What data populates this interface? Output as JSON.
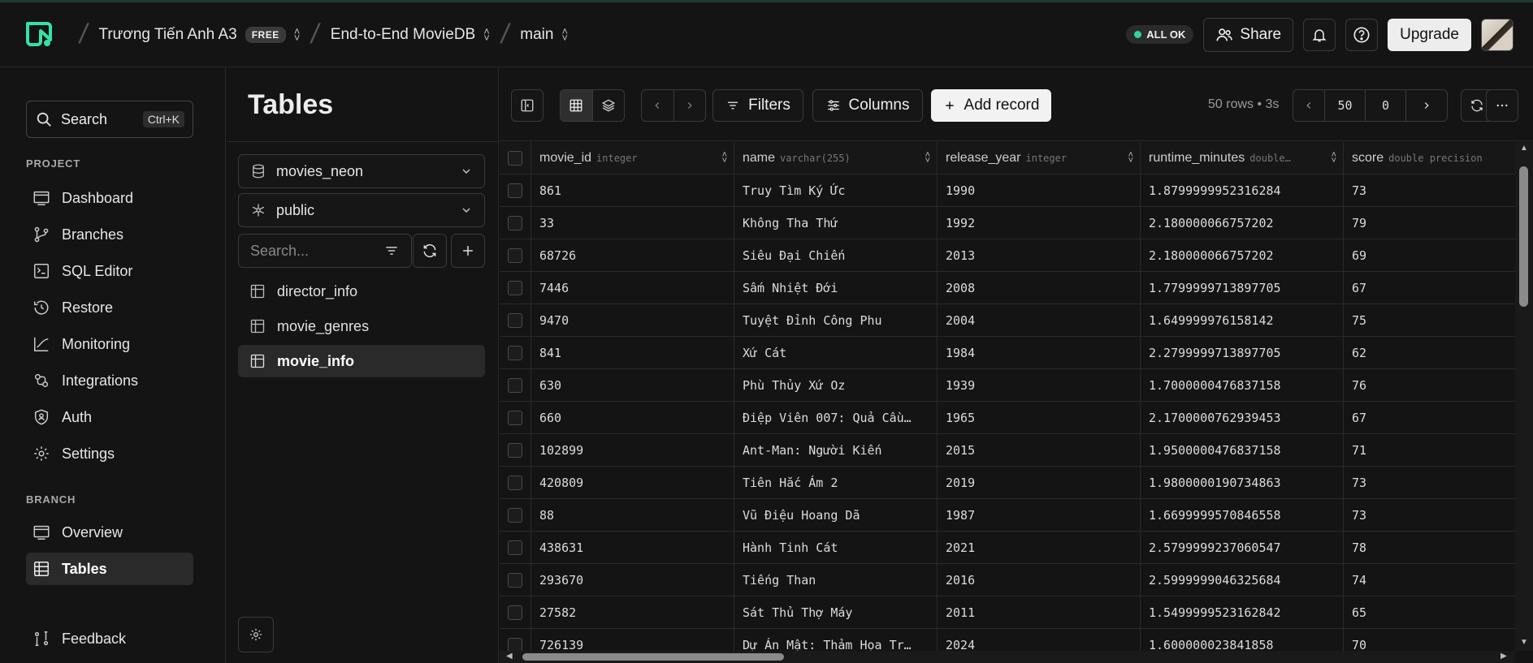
{
  "header": {
    "org": "Trương Tiến Anh A3",
    "plan_badge": "FREE",
    "project": "End-to-End MovieDB",
    "branch": "main",
    "status": "ALL OK",
    "share_label": "Share",
    "upgrade_label": "Upgrade"
  },
  "sidebar": {
    "search_label": "Search",
    "search_shortcut": "Ctrl+K",
    "project_section": "PROJECT",
    "project_items": [
      "Dashboard",
      "Branches",
      "SQL Editor",
      "Restore",
      "Monitoring",
      "Integrations",
      "Auth",
      "Settings"
    ],
    "branch_section": "BRANCH",
    "branch_items": [
      "Overview",
      "Tables"
    ],
    "feedback": "Feedback"
  },
  "tables_panel": {
    "title": "Tables",
    "database": "movies_neon",
    "schema": "public",
    "search_placeholder": "Search...",
    "tables": [
      "director_info",
      "movie_genres",
      "movie_info"
    ],
    "active_table": "movie_info"
  },
  "toolbar": {
    "filters_label": "Filters",
    "columns_label": "Columns",
    "add_record_label": "Add record",
    "rows_info": "50 rows • 3s",
    "limit": "50",
    "offset": "0"
  },
  "grid": {
    "columns": [
      {
        "name": "movie_id",
        "type": "integer"
      },
      {
        "name": "name",
        "type": "varchar(255)"
      },
      {
        "name": "release_year",
        "type": "integer"
      },
      {
        "name": "runtime_minutes",
        "type": "double…"
      },
      {
        "name": "score",
        "type": "double precision"
      }
    ],
    "rows": [
      [
        "861",
        "Truy Tìm Ký Ức",
        "1990",
        "1.8799999952316284",
        "73"
      ],
      [
        "33",
        "Không Tha Thứ",
        "1992",
        "2.180000066757202",
        "79"
      ],
      [
        "68726",
        "Siêu Đại Chiến",
        "2013",
        "2.180000066757202",
        "69"
      ],
      [
        "7446",
        "Sấm Nhiệt Đới",
        "2008",
        "1.7799999713897705",
        "67"
      ],
      [
        "9470",
        "Tuyệt Đỉnh Công Phu",
        "2004",
        "1.649999976158142",
        "75"
      ],
      [
        "841",
        "Xứ Cát",
        "1984",
        "2.2799999713897705",
        "62"
      ],
      [
        "630",
        "Phù Thủy Xứ Oz",
        "1939",
        "1.7000000476837158",
        "76"
      ],
      [
        "660",
        "Điệp Viên 007: Quả Cầu…",
        "1965",
        "2.1700000762939453",
        "67"
      ],
      [
        "102899",
        "Ant-Man: Người Kiến",
        "2015",
        "1.9500000476837158",
        "71"
      ],
      [
        "420809",
        "Tiên Hắc Ám 2",
        "2019",
        "1.9800000190734863",
        "73"
      ],
      [
        "88",
        "Vũ Điệu Hoang Dã",
        "1987",
        "1.6699999570846558",
        "73"
      ],
      [
        "438631",
        "Hành Tinh Cát",
        "2021",
        "2.5799999237060547",
        "78"
      ],
      [
        "293670",
        "Tiếng Than",
        "2016",
        "2.5999999046325684",
        "74"
      ],
      [
        "27582",
        "Sát Thủ Thợ Máy",
        "2011",
        "1.5499999523162842",
        "65"
      ],
      [
        "726139",
        "Dự Án Mật: Thảm Họa Tr…",
        "2024",
        "1.600000023841858",
        "70"
      ]
    ]
  }
}
